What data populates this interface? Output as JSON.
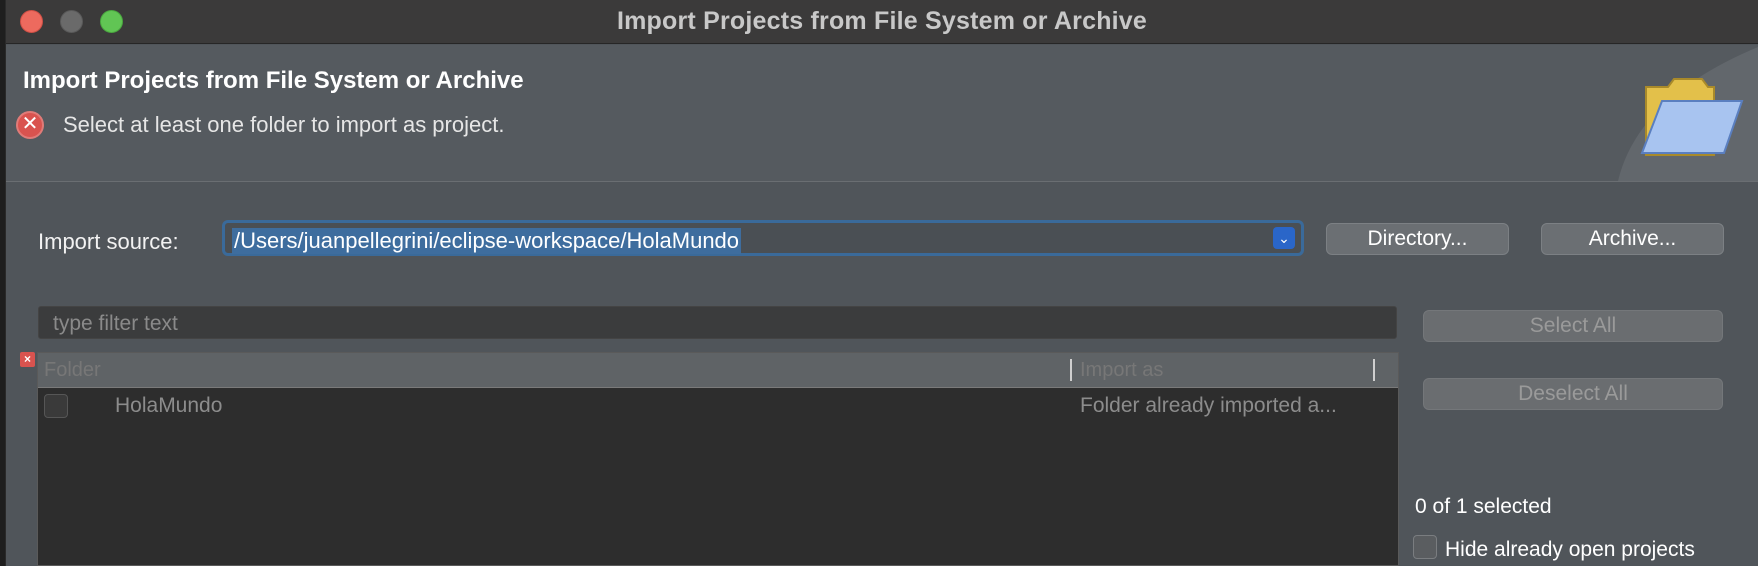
{
  "window": {
    "title": "Import Projects from File System or Archive"
  },
  "banner": {
    "title": "Import Projects from File System or Archive",
    "message": "Select at least one folder to import as project.",
    "graphic": "folder-open-icon"
  },
  "import_source": {
    "label": "Import source:",
    "value": "/Users/juanpellegrini/eclipse-workspace/HolaMundo",
    "directory_button": "Directory...",
    "archive_button": "Archive..."
  },
  "filter": {
    "placeholder": "type filter text"
  },
  "table": {
    "columns": [
      "Folder",
      "Import as"
    ],
    "rows": [
      {
        "checked": false,
        "folder": "HolaMundo",
        "import_as": "Folder already imported a..."
      }
    ]
  },
  "actions": {
    "select_all": "Select All",
    "deselect_all": "Deselect All"
  },
  "status": {
    "selected_count": "0 of 1 selected"
  },
  "options": {
    "hide_open_projects_label": "Hide already open projects",
    "hide_open_projects_checked": false
  }
}
